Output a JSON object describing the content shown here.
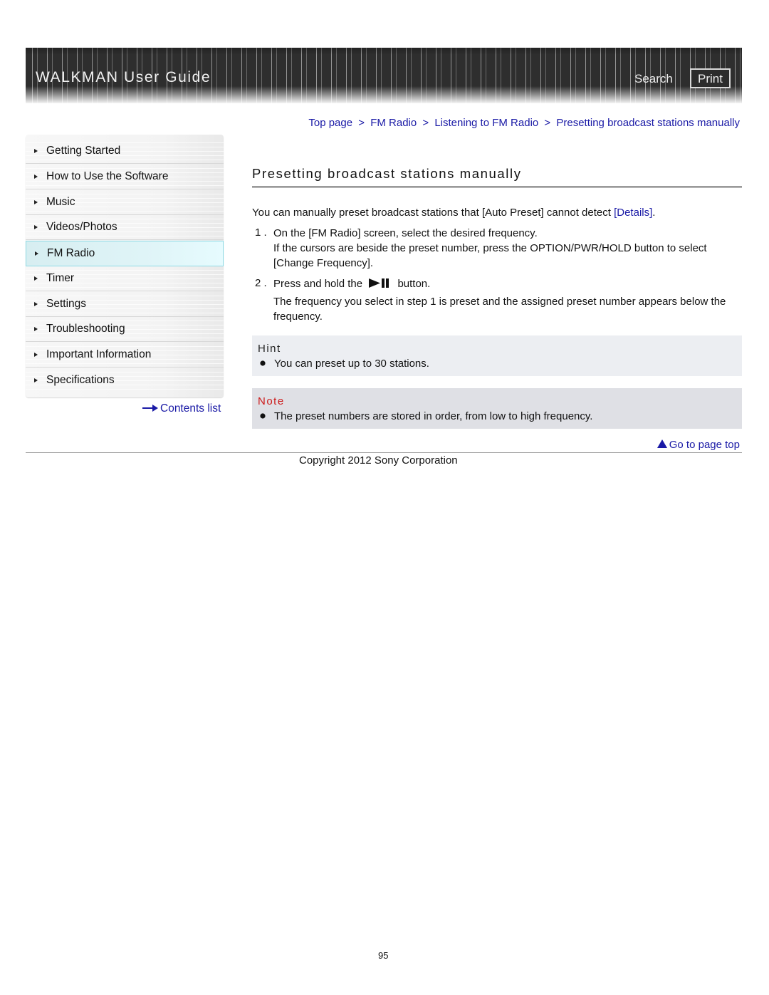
{
  "header": {
    "title": "WALKMAN User Guide",
    "search_label": "Search",
    "print_label": "Print"
  },
  "breadcrumb": {
    "items": [
      "Top page",
      "FM Radio",
      "Listening to FM Radio",
      "Presetting broadcast stations manually"
    ],
    "separator": ">"
  },
  "sidebar": {
    "items": [
      {
        "label": "Getting Started",
        "active": false
      },
      {
        "label": "How to Use the Software",
        "active": false
      },
      {
        "label": "Music",
        "active": false
      },
      {
        "label": "Videos/Photos",
        "active": false
      },
      {
        "label": "FM Radio",
        "active": true
      },
      {
        "label": "Timer",
        "active": false
      },
      {
        "label": "Settings",
        "active": false
      },
      {
        "label": "Troubleshooting",
        "active": false
      },
      {
        "label": "Important Information",
        "active": false
      },
      {
        "label": "Specifications",
        "active": false
      }
    ],
    "contents_link": "Contents list"
  },
  "main": {
    "title": "Presetting broadcast stations manually",
    "intro_text": "You can manually preset broadcast stations that [Auto Preset] cannot detect ",
    "intro_link": "[Details]",
    "intro_end": ".",
    "steps": [
      {
        "number": "1 .",
        "text": "On the [FM Radio] screen, select the desired frequency.",
        "detail": "If the cursors are beside the preset number, press the OPTION/PWR/HOLD button to select [Change Frequency]."
      },
      {
        "number": "2 .",
        "text_before": "Press and hold the",
        "icon": "play-pause-icon",
        "text_after": "button.",
        "detail": "The frequency you select in step 1  is preset and the assigned preset number appears below the frequency."
      }
    ],
    "hint": {
      "heading": "Hint",
      "items": [
        "You can preset up to 30 stations."
      ]
    },
    "note": {
      "heading": "Note",
      "items": [
        "The preset numbers are stored in order, from low to high frequency."
      ]
    }
  },
  "footer": {
    "go_top_label": "Go to page top",
    "copyright": "Copyright 2012 Sony Corporation",
    "page_number": "95"
  },
  "colors": {
    "link": "#1a1aa6",
    "note_heading": "#cc1a1a",
    "header_bg": "#2e2e2e",
    "active_nav_bg": "#dff4f7",
    "hint_bg": "#eceef2",
    "note_bg": "#dfe0e5"
  }
}
